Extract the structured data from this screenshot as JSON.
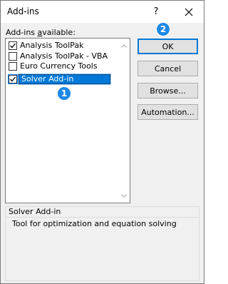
{
  "window": {
    "title": "Add-ins",
    "help_label": "?"
  },
  "list": {
    "label_prefix": "Add-ins ",
    "label_accel": "a",
    "label_suffix": "vailable:",
    "items": [
      {
        "label": "Analysis ToolPak",
        "checked": true,
        "selected": false
      },
      {
        "label": "Analysis ToolPak - VBA",
        "checked": false,
        "selected": false
      },
      {
        "label": "Euro Currency Tools",
        "checked": false,
        "selected": false
      },
      {
        "label": "Solver Add-in",
        "checked": true,
        "selected": true
      }
    ]
  },
  "buttons": {
    "ok": "OK",
    "cancel": "Cancel",
    "browse": "Browse...",
    "automation": "Automation..."
  },
  "description": {
    "title": "Solver Add-in",
    "text": "Tool for optimization and equation solving"
  },
  "annotations": {
    "badge1": "1",
    "badge2": "2"
  },
  "colors": {
    "accent": "#0078d7",
    "badge": "#1e88e5",
    "selection": "#0078d7"
  }
}
